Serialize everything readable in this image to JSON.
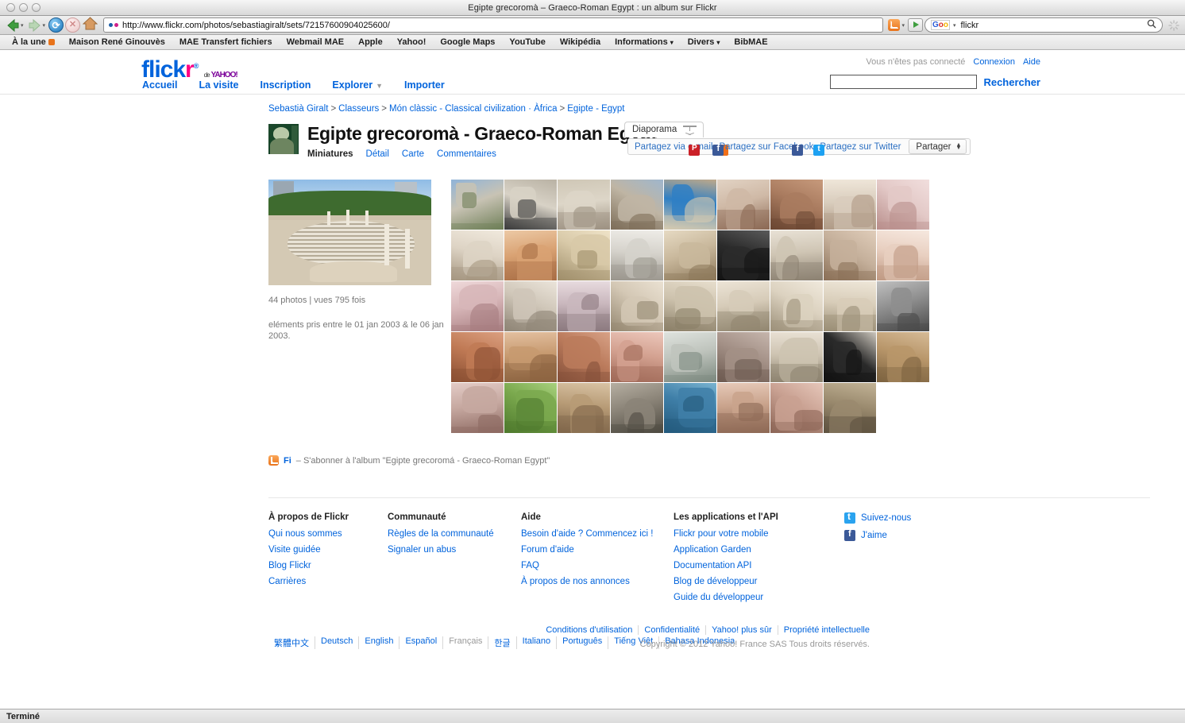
{
  "window": {
    "title": "Egipte grecoromà – Graeco-Roman Egypt : un album sur Flickr"
  },
  "toolbar": {
    "url": "http://www.flickr.com/photos/sebastiagiralt/sets/72157600904025600/",
    "search_value": "flickr",
    "back_label": "Précédent",
    "forward_label": "Suivant",
    "reload_label": "Recharger",
    "stop_label": "Arrêter",
    "home_label": "Accueil"
  },
  "bookmarks": [
    {
      "label": "À la une",
      "caret": false,
      "rss": true
    },
    {
      "label": "Maison René Ginouvès",
      "caret": false,
      "rss": false
    },
    {
      "label": "MAE Transfert fichiers",
      "caret": false,
      "rss": false
    },
    {
      "label": "Webmail MAE",
      "caret": false,
      "rss": false
    },
    {
      "label": "Apple",
      "caret": false,
      "rss": false
    },
    {
      "label": "Yahoo!",
      "caret": false,
      "rss": false
    },
    {
      "label": "Google Maps",
      "caret": false,
      "rss": false
    },
    {
      "label": "YouTube",
      "caret": false,
      "rss": false
    },
    {
      "label": "Wikipédia",
      "caret": false,
      "rss": false
    },
    {
      "label": "Informations",
      "caret": true,
      "rss": false
    },
    {
      "label": "Divers",
      "caret": true,
      "rss": false
    },
    {
      "label": "BibMAE",
      "caret": false,
      "rss": false
    }
  ],
  "statusbar": {
    "text": "Terminé"
  },
  "flickr": {
    "logo": {
      "flick": "flick",
      "r": "r",
      "de": "de",
      "yahoo": "YAHOO!"
    },
    "nav": [
      {
        "label": "Accueil",
        "caret": false
      },
      {
        "label": "La visite",
        "caret": false
      },
      {
        "label": "Inscription",
        "caret": false
      },
      {
        "label": "Explorer",
        "caret": true
      },
      {
        "label": "Importer",
        "caret": false
      }
    ],
    "account": {
      "status": "Vous n'êtes pas connecté",
      "signin": "Connexion",
      "help": "Aide"
    },
    "search": {
      "value": "",
      "placeholder": "",
      "button": "Rechercher"
    },
    "breadcrumb": [
      "Sebastià Giralt",
      "Classeurs",
      "Món clàssic - Classical civilization · Àfrica",
      "Egipte - Egypt"
    ],
    "breadcrumb_separator": ">",
    "album": {
      "title": "Egipte grecoromà - Graeco-Roman Egypt",
      "tabs": [
        {
          "label": "Miniatures",
          "active": true
        },
        {
          "label": "Détail",
          "active": false
        },
        {
          "label": "Carte",
          "active": false
        },
        {
          "label": "Commentaires",
          "active": false
        }
      ],
      "slideshow_label": "Diaporama",
      "share": {
        "email": "Partagez via e-mail",
        "facebook": "Partagez sur Facebook",
        "twitter": "Partagez sur Twitter",
        "button": "Partager"
      },
      "stats": "44 photos | vues 795 fois",
      "dates": "eléments pris entre le 01 jan 2003 & le 06 jan 2003.",
      "photo_count": 44
    },
    "feed": {
      "badge": "Fi",
      "text": "– S'abonner à l'album \"Egipte grecoromá - Graeco-Roman Egypt\""
    },
    "footer": {
      "columns": [
        {
          "heading": "À propos de Flickr",
          "links": [
            "Qui nous sommes",
            "Visite guidée",
            "Blog Flickr",
            "Carrières"
          ]
        },
        {
          "heading": "Communauté",
          "links": [
            "Règles de la communauté",
            "Signaler un abus"
          ]
        },
        {
          "heading": "Aide",
          "links": [
            "Besoin d'aide ? Commencez ici !",
            "Forum d'aide",
            "FAQ",
            "À propos de nos annonces"
          ]
        },
        {
          "heading": "Les applications et l'API",
          "links": [
            "Flickr pour votre mobile",
            "Application Garden",
            "Documentation API",
            "Blog de développeur",
            "Guide du développeur"
          ]
        }
      ],
      "social": [
        {
          "label": "Suivez-nous",
          "icon": "twitter-icon"
        },
        {
          "label": "J'aime",
          "icon": "facebook-icon"
        }
      ],
      "languages": [
        {
          "label": "繁體中文",
          "current": false
        },
        {
          "label": "Deutsch",
          "current": false
        },
        {
          "label": "English",
          "current": false
        },
        {
          "label": "Español",
          "current": false
        },
        {
          "label": "Français",
          "current": true
        },
        {
          "label": "한글",
          "current": false
        },
        {
          "label": "Italiano",
          "current": false
        },
        {
          "label": "Português",
          "current": false
        },
        {
          "label": "Tiếng Việt",
          "current": false
        },
        {
          "label": "Bahasa Indonesia",
          "current": false
        }
      ],
      "legal": [
        "Conditions d'utilisation",
        "Confidentialité",
        "Yahoo! plus sûr",
        "Propriété intellectuelle"
      ],
      "copyright": "Copyright © 2012 Yahoo! France SAS Tous droits réservés."
    }
  },
  "colors": {
    "flickr_blue": "#0063dc",
    "flickr_pink": "#ff0084",
    "link": "#0063dc",
    "rss_orange": "#e8731b",
    "facebook": "#3b5998",
    "twitter": "#1da1f2"
  },
  "gallery": {
    "rows": [
      9,
      9,
      9,
      9,
      8
    ],
    "thumbs": [
      {
        "a": "#c8c3b4",
        "b": "#6f7f58",
        "c": "#8fb3d8"
      },
      {
        "a": "#d8d2c6",
        "b": "#3b3b3b",
        "c": "#b9b2a4"
      },
      {
        "a": "#ddd6c8",
        "b": "#9d9282",
        "c": "#cfc7b6"
      },
      {
        "a": "#bfb5a4",
        "b": "#7e6e59",
        "c": "#9fb6cd"
      },
      {
        "a": "#2f7fc4",
        "b": "#d8cbb0",
        "c": "#bfa98a"
      },
      {
        "a": "#cfb9a6",
        "b": "#8c6a55",
        "c": "#e2d3c4"
      },
      {
        "a": "#a97b5f",
        "b": "#6b4733",
        "c": "#c79a7c"
      },
      {
        "a": "#d9cdbd",
        "b": "#b09a86",
        "c": "#efe6d9"
      },
      {
        "a": "#e3c9c7",
        "b": "#b98f8c",
        "c": "#f1dedd"
      },
      {
        "a": "#ddd3c4",
        "b": "#a69781",
        "c": "#f0e9dd"
      },
      {
        "a": "#d9a273",
        "b": "#a96f46",
        "c": "#ecc9a5"
      },
      {
        "a": "#d8c9a8",
        "b": "#a08f6b",
        "c": "#efe3c8"
      },
      {
        "a": "#d5d2cb",
        "b": "#9b978e",
        "c": "#eeece7"
      },
      {
        "a": "#c9b89c",
        "b": "#8e7a5c",
        "c": "#e6dac3"
      },
      {
        "a": "#2b2b2b",
        "b": "#141414",
        "c": "#5a5a5a"
      },
      {
        "a": "#cfc5b4",
        "b": "#8d8272",
        "c": "#e8e1d5"
      },
      {
        "a": "#c5b09b",
        "b": "#8b7158",
        "c": "#e0cdba"
      },
      {
        "a": "#e8cfc0",
        "b": "#c09a84",
        "c": "#f6e8df"
      },
      {
        "a": "#d7b6b8",
        "b": "#a77d80",
        "c": "#efd9da"
      },
      {
        "a": "#cfc6b8",
        "b": "#8f8576",
        "c": "#ebe4da"
      },
      {
        "a": "#c9b7bd",
        "b": "#8d7a80",
        "c": "#e7dade"
      },
      {
        "a": "#d4c8b5",
        "b": "#958871",
        "c": "#eae1d2"
      },
      {
        "a": "#cdc2ad",
        "b": "#8b8068",
        "c": "#e7decd"
      },
      {
        "a": "#d6cbb8",
        "b": "#928670",
        "c": "#ece4d6"
      },
      {
        "a": "#dcd2c0",
        "b": "#9d917a",
        "c": "#f0e9dc"
      },
      {
        "a": "#d8cdb9",
        "b": "#9a8e76",
        "c": "#eee6d8"
      },
      {
        "a": "#8e8e8e",
        "b": "#4a4a4a",
        "c": "#c0c0c0"
      },
      {
        "a": "#c07a55",
        "b": "#8a4f33",
        "c": "#dba081"
      },
      {
        "a": "#c79a70",
        "b": "#8d6441",
        "c": "#e3c0a0"
      },
      {
        "a": "#bb7b5c",
        "b": "#85503a",
        "c": "#d8a287"
      },
      {
        "a": "#d3a190",
        "b": "#a06a58",
        "c": "#ecc7bb"
      },
      {
        "a": "#bfc4bd",
        "b": "#7d8a80",
        "c": "#dfe3de"
      },
      {
        "a": "#a39086",
        "b": "#6d5b51",
        "c": "#c6b6ad"
      },
      {
        "a": "#cec4b2",
        "b": "#8e8471",
        "c": "#e9e1d4"
      },
      {
        "a": "#2a2a2a",
        "b": "#121212",
        "c": "#cdc7bd"
      },
      {
        "a": "#b8966a",
        "b": "#7d6340",
        "c": "#d6bb97"
      },
      {
        "a": "#c6a8a0",
        "b": "#8e6b63",
        "c": "#e3cbc6"
      },
      {
        "a": "#7aa84d",
        "b": "#4f7a2e",
        "c": "#a8d17d"
      },
      {
        "a": "#b79b76",
        "b": "#80664a",
        "c": "#d9c3a4"
      },
      {
        "a": "#8b8478",
        "b": "#4e4a41",
        "c": "#b6afa2"
      },
      {
        "a": "#3f7fa8",
        "b": "#245a7c",
        "c": "#79b3d0"
      },
      {
        "a": "#c9a38c",
        "b": "#8e6a56",
        "c": "#e6c9b8"
      },
      {
        "a": "#c9a192",
        "b": "#8d6657",
        "c": "#e6c7ba"
      },
      {
        "a": "#9a8a6e",
        "b": "#5f5340",
        "c": "#c2b396"
      }
    ]
  }
}
